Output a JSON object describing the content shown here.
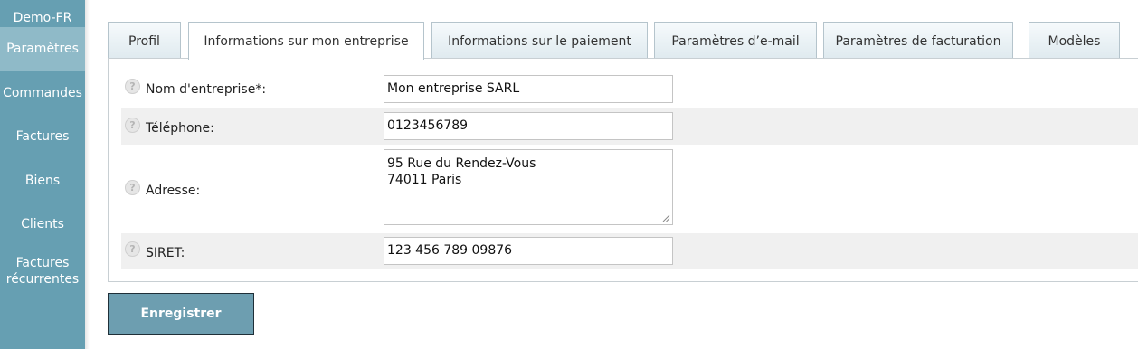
{
  "sidebar": {
    "brand": "Demo-FR",
    "items": [
      {
        "label": "Paramètres"
      },
      {
        "label": "Commandes"
      },
      {
        "label": "Factures"
      },
      {
        "label": "Biens"
      },
      {
        "label": "Clients"
      },
      {
        "label_line1": "Factures",
        "label_line2": "récurrentes"
      }
    ]
  },
  "tabs": [
    {
      "label": "Profil"
    },
    {
      "label": "Informations sur mon entreprise"
    },
    {
      "label": "Informations sur le paiement"
    },
    {
      "label": "Paramètres d’e-mail"
    },
    {
      "label": "Paramètres de facturation"
    },
    {
      "label": "Modèles"
    }
  ],
  "form": {
    "company": {
      "label": "Nom d'entreprise*:",
      "value": "Mon entreprise SARL"
    },
    "phone": {
      "label": "Téléphone:",
      "value": "0123456789"
    },
    "address": {
      "label": "Adresse:",
      "line1": "95 Rue du Rendez-Vous",
      "line2": "74011 Paris"
    },
    "siret": {
      "label": "SIRET:",
      "value": "123 456 789 09876"
    },
    "help_glyph": "?"
  },
  "actions": {
    "save_label": "Enregistrer"
  },
  "colors": {
    "sidebar": "#669fb2",
    "sidebar_active": "#8fbac8",
    "button": "#6d9eb0"
  }
}
